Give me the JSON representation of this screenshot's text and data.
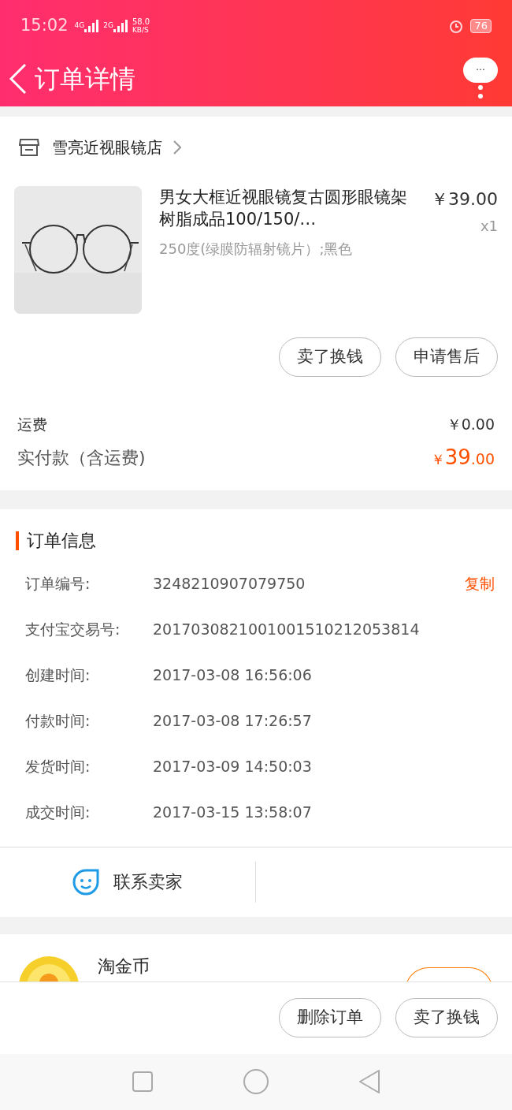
{
  "status_bar": {
    "time": "15:02",
    "net_1": "4G",
    "net_2": "2G",
    "speed": "58.0",
    "speed_unit": "KB/S",
    "battery": "76"
  },
  "nav": {
    "title": "订单详情",
    "more": "···"
  },
  "shop": {
    "name": "雪亮近视眼镜店"
  },
  "product": {
    "title": "男女大框近视眼镜复古圆形眼镜架树脂成品100/150/…",
    "spec": "250度(绿膜防辐射镜片）;黑色",
    "price": "￥39.00",
    "qty": "x1"
  },
  "item_buttons": [
    "卖了换钱",
    "申请售后"
  ],
  "fees": {
    "shipping_label": "运费",
    "shipping_value": "￥0.00",
    "paid_label": "实付款（含运费)",
    "paid_currency": "￥",
    "paid_int": "39",
    "paid_dec": ".00"
  },
  "order_info": {
    "title": "订单信息",
    "copy": "复制",
    "rows": [
      {
        "label": "订单编号:",
        "value": "3248210907079750"
      },
      {
        "label": "支付宝交易号:",
        "value": "2017030821001001510212053814"
      },
      {
        "label": "创建时间:",
        "value": "2017-03-08 16:56:06"
      },
      {
        "label": "付款时间:",
        "value": "2017-03-08 17:26:57"
      },
      {
        "label": "发货时间:",
        "value": "2017-03-09 14:50:03"
      },
      {
        "label": "成交时间:",
        "value": "2017-03-15 13:58:07"
      }
    ]
  },
  "contact": {
    "label": "联系卖家"
  },
  "coins": {
    "title": "淘金币"
  },
  "bottom_buttons": [
    "删除订单",
    "卖了换钱"
  ]
}
